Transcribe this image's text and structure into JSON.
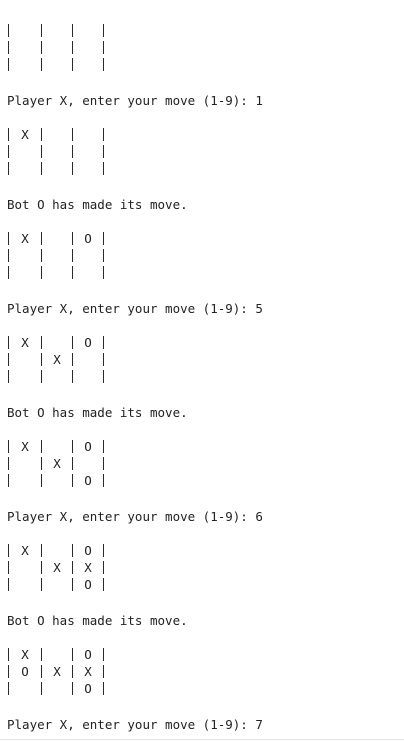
{
  "console": {
    "board_0": [
      [
        "",
        "",
        ""
      ],
      [
        "",
        "",
        ""
      ],
      [
        "",
        "",
        ""
      ]
    ],
    "prompt_1": "Player X, enter your move (1-9): 1",
    "board_1": [
      [
        "X",
        "",
        ""
      ],
      [
        "",
        "",
        ""
      ],
      [
        "",
        "",
        ""
      ]
    ],
    "bot_1": "Bot O has made its move.",
    "board_2": [
      [
        "X",
        "",
        "O"
      ],
      [
        "",
        "",
        ""
      ],
      [
        "",
        "",
        ""
      ]
    ],
    "prompt_2": "Player X, enter your move (1-9): 5",
    "board_3": [
      [
        "X",
        "",
        "O"
      ],
      [
        "",
        "X",
        ""
      ],
      [
        "",
        "",
        ""
      ]
    ],
    "bot_2": "Bot O has made its move.",
    "board_4": [
      [
        "X",
        "",
        "O"
      ],
      [
        "",
        "X",
        ""
      ],
      [
        "",
        "",
        "O"
      ]
    ],
    "prompt_3": "Player X, enter your move (1-9): 6",
    "board_5": [
      [
        "X",
        "",
        "O"
      ],
      [
        "",
        "X",
        "X"
      ],
      [
        "",
        "",
        "O"
      ]
    ],
    "bot_3": "Bot O has made its move.",
    "board_6": [
      [
        "X",
        "",
        "O"
      ],
      [
        "O",
        "X",
        "X"
      ],
      [
        "",
        "",
        "O"
      ]
    ],
    "prompt_4": "Player X, enter your move (1-9): 7"
  }
}
